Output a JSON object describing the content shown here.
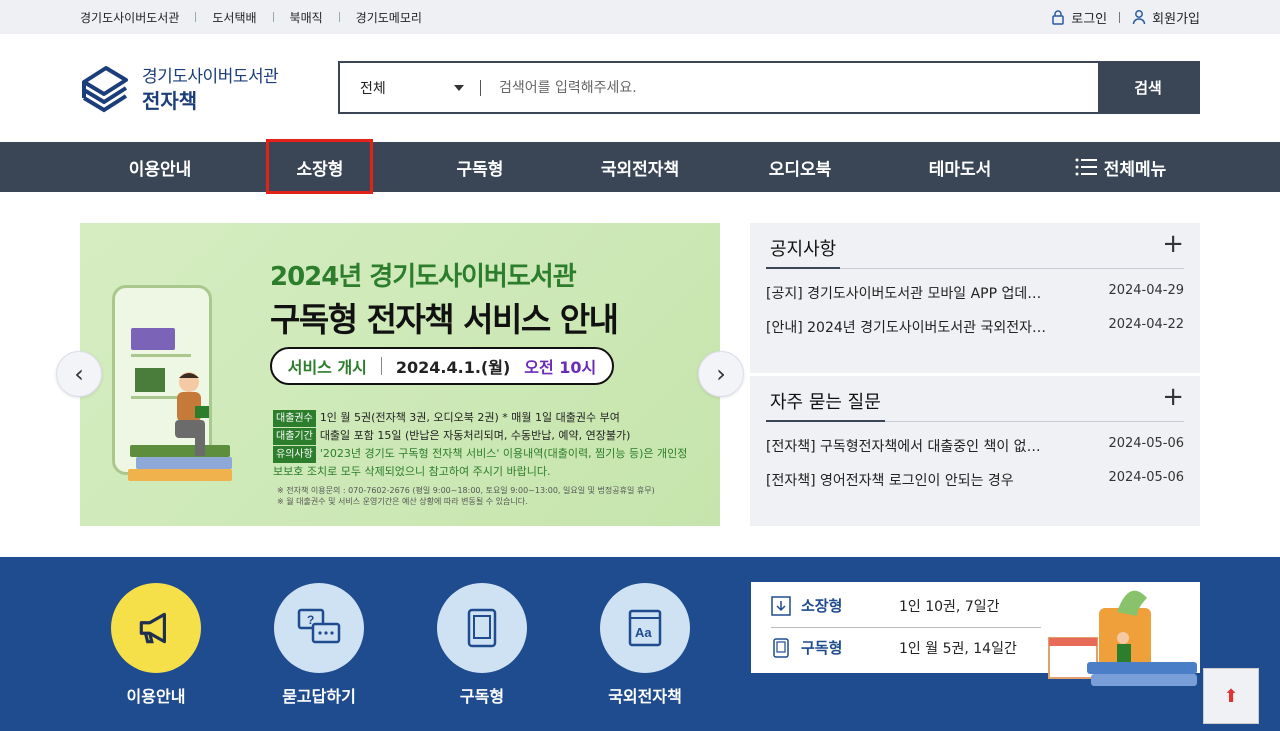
{
  "top_links": [
    "경기도사이버도서관",
    "도서택배",
    "북매직",
    "경기도메모리"
  ],
  "auth": {
    "login": "로그인",
    "join": "회원가입"
  },
  "logo": {
    "line1": "경기도사이버도서관",
    "line2": "전자책"
  },
  "search": {
    "category": "전체",
    "placeholder": "검색어를 입력해주세요.",
    "button": "검색"
  },
  "gnb": [
    "이용안내",
    "소장형",
    "구독형",
    "국외전자책",
    "오디오북",
    "테마도서",
    "전체메뉴"
  ],
  "banner": {
    "title1": "2024년 경기도사이버도서관",
    "title2": "구독형 전자책 서비스 안내",
    "pill_a": "서비스 개시",
    "pill_b": "2024.4.1.(월)",
    "pill_c": "오전 10시",
    "rows": [
      {
        "tag": "대출권수",
        "text": "1인 월 5권(전자책 3권, 오디오북 2권) * 매월 1일 대출권수 부여"
      },
      {
        "tag": "대출기간",
        "text": "대출일 포함 15일 (반납은 자동처리되며, 수동반납, 예약, 연장불가)"
      },
      {
        "tag": "유의사항",
        "text": "'2023년 경기도 구독형 전자책 서비스' 이용내역(대출이력, 찜기능 등)은 개인정보보호 조치로 모두 삭제되었으니 참고하여 주시기 바랍니다."
      }
    ],
    "note1": "※ 전자책 이용문의 : 070-7602-2676 (평일 9:00~18:00, 토요일 9:00~13:00, 일요일 및 법정공휴일 휴무)",
    "note2": "※ 월 대출권수 및 서비스 운영기간은 예산 상황에 따라 변동될 수 있습니다."
  },
  "notice": {
    "title": "공지사항",
    "items": [
      {
        "text": "[공지] 경기도사이버도서관 모바일 APP 업데…",
        "date": "2024-04-29"
      },
      {
        "text": "[안내] 2024년 경기도사이버도서관 국외전자…",
        "date": "2024-04-22"
      }
    ]
  },
  "faq": {
    "title": "자주 묻는 질문",
    "items": [
      {
        "text": "[전자책] 구독형전자책에서 대출중인 책이 없…",
        "date": "2024-05-06"
      },
      {
        "text": "[전자책] 영어전자책 로그인이 안되는 경우",
        "date": "2024-05-06"
      }
    ]
  },
  "quick": [
    "이용안내",
    "묻고답하기",
    "구독형",
    "국외전자책"
  ],
  "loan": [
    {
      "label": "소장형",
      "value": "1인 10권, 7일간"
    },
    {
      "label": "구독형",
      "value": "1인 월 5권, 14일간"
    }
  ],
  "colors": {
    "nav": "#3a4656",
    "accent_blue": "#1f4b8f",
    "highlight": "#e3231a",
    "quick_yellow": "#f5e04a",
    "quick_light": "#cfe2f3"
  }
}
